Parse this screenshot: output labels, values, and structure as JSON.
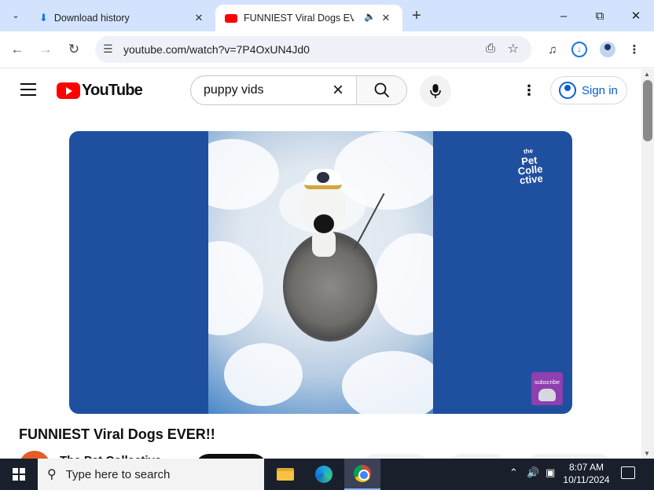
{
  "browser": {
    "tabs": [
      {
        "label": "Download history"
      },
      {
        "label": "FUNNIEST Viral Dogs EVER!!"
      }
    ],
    "url": "youtube.com/watch?v=7P4OxUN4Jd0",
    "icons": {
      "tab_search": "chevron-down-icon",
      "download_tab": "download-icon",
      "youtube_tab": "youtube-icon",
      "audio": "speaker-icon",
      "close": "close-icon",
      "new_tab": "plus-icon",
      "back": "back-arrow-icon",
      "forward": "forward-arrow-icon",
      "reload": "reload-icon",
      "site_info": "tune-icon",
      "install": "install-app-icon",
      "bookmark": "star-icon",
      "media": "media-control-icon",
      "downloads": "download-circle-icon",
      "profile": "profile-icon",
      "menu": "kebab-icon"
    }
  },
  "youtube": {
    "logo_text": "YouTube",
    "search_value": "puppy vids",
    "signin_label": "Sign in",
    "brand_color": "#ff0000",
    "link_color": "#065fd4"
  },
  "video": {
    "title": "FUNNIEST Viral Dogs EVER!!",
    "channel_logo_text": [
      "Pet",
      "Colle",
      "ctive"
    ],
    "channel_logo_prefix": "the",
    "subscribe_overlay": "subscribe",
    "background_color": "#1f4f9f"
  },
  "channel": {
    "name": "The Pet Collective"
  },
  "taskbar": {
    "search_placeholder": "Type here to search",
    "time": "8:07 AM",
    "date": "10/11/2024",
    "apps": [
      "file-explorer-icon",
      "edge-icon",
      "chrome-icon"
    ]
  }
}
